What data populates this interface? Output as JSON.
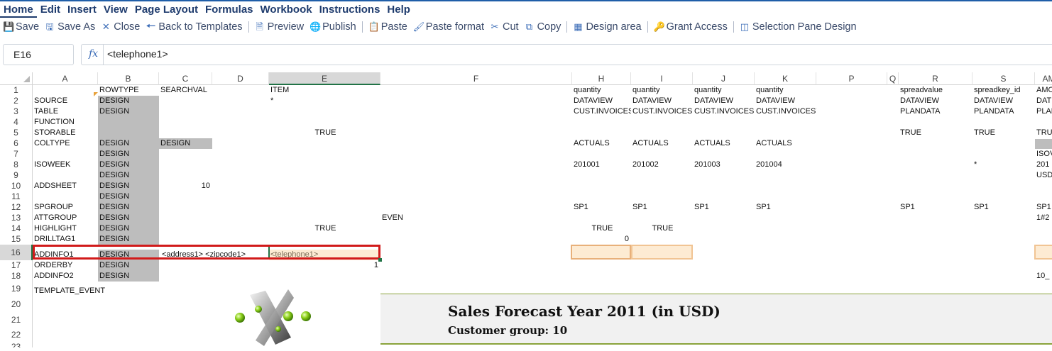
{
  "menu": [
    "Home",
    "Edit",
    "Insert",
    "View",
    "Page Layout",
    "Formulas",
    "Workbook",
    "Instructions",
    "Help"
  ],
  "toolbar": [
    {
      "label": "Save",
      "icon": "save-icon"
    },
    {
      "label": "Save As",
      "icon": "save-as-icon"
    },
    {
      "label": "Close",
      "icon": "close-icon"
    },
    {
      "label": "Back to Templates",
      "icon": "arrow-left-icon"
    },
    {
      "label": "Preview",
      "icon": "preview-icon"
    },
    {
      "label": "Publish",
      "icon": "globe-icon"
    },
    {
      "label": "Paste",
      "icon": "paste-icon"
    },
    {
      "label": "Paste format",
      "icon": "format-painter-icon"
    },
    {
      "label": "Cut",
      "icon": "scissors-icon"
    },
    {
      "label": "Copy",
      "icon": "copy-icon"
    },
    {
      "label": "Design area",
      "icon": "grid-icon"
    },
    {
      "label": "Grant Access",
      "icon": "key-icon"
    },
    {
      "label": "Selection Pane Design",
      "icon": "selection-pane-icon"
    }
  ],
  "namebox": "E16",
  "formula": "<telephone1>",
  "columns": [
    "A",
    "B",
    "C",
    "D",
    "E",
    "F",
    "H",
    "I",
    "J",
    "K",
    "P",
    "Q",
    "R",
    "S",
    "AM"
  ],
  "rows": [
    "1",
    "2",
    "3",
    "4",
    "5",
    "6",
    "7",
    "8",
    "9",
    "10",
    "11",
    "12",
    "13",
    "14",
    "15",
    "16",
    "17",
    "18",
    "19",
    "20",
    "21",
    "22",
    "23"
  ],
  "cells": {
    "A": [
      "",
      "SOURCE",
      "TABLE",
      "FUNCTION",
      "STORABLE",
      "COLTYPE",
      "",
      "ISOWEEK",
      "",
      "ADDSHEET",
      "",
      "SPGROUP",
      "ATTGROUP",
      "HIGHLIGHT",
      "DRILLTAG1",
      "ADDINFO1",
      "ORDERBY",
      "ADDINFO2",
      "TEMPLATE_EVENT"
    ],
    "B": [
      "ROWTYPE",
      "DESIGN",
      "DESIGN",
      "",
      "",
      "DESIGN",
      "DESIGN",
      "DESIGN",
      "DESIGN",
      "DESIGN",
      "DESIGN",
      "DESIGN",
      "DESIGN",
      "DESIGN",
      "DESIGN",
      "DESIGN",
      "DESIGN",
      "DESIGN"
    ],
    "C1": "SEARCHVAL",
    "C6": "DESIGN",
    "C10": "10",
    "C16": "<address1>  <zipcode1>",
    "E1": "ITEM",
    "E2": "*",
    "E5": "TRUE",
    "E14": "TRUE",
    "E16": "<telephone1>",
    "E17": "1",
    "F13": "EVEN",
    "H": [
      "quantity",
      "DATAVIEW",
      "CUST.INVOICES",
      "",
      "",
      "ACTUALS",
      "",
      "201001",
      "",
      "",
      "",
      "SP1",
      "",
      "TRUE",
      "0"
    ],
    "I": [
      "quantity",
      "DATAVIEW",
      "CUST.INVOICES",
      "",
      "",
      "ACTUALS",
      "",
      "201002",
      "",
      "",
      "",
      "SP1",
      "",
      "TRUE"
    ],
    "J": [
      "quantity",
      "DATAVIEW",
      "CUST.INVOICES",
      "",
      "",
      "ACTUALS",
      "",
      "201003",
      "",
      "",
      "",
      "SP1"
    ],
    "K": [
      "quantity",
      "DATAVIEW",
      "CUST.INVOICESTAT",
      "",
      "",
      "ACTUALS",
      "",
      "201004",
      "",
      "",
      "",
      "SP1"
    ],
    "R": [
      "spreadvalue",
      "DATAVIEW",
      "PLANDATA",
      "",
      "TRUE",
      "",
      "",
      "",
      "",
      "",
      "",
      "SP1"
    ],
    "S": [
      "spreadkey_id",
      "DATAVIEW",
      "PLANDATA",
      "",
      "TRUE",
      "",
      "",
      "*",
      "",
      "",
      "",
      "SP1"
    ],
    "AM": [
      "AMO",
      "DAT",
      "PLAN",
      "",
      "TRU",
      "",
      "ISOV",
      "201",
      "USD",
      "",
      "",
      "SP1",
      "1#2",
      "",
      "",
      "",
      "",
      "10_"
    ]
  },
  "banner": {
    "title": "Sales Forecast Year 2011 (in USD)",
    "subtitle": "Customer group: 10"
  },
  "colors": {
    "accent": "#1f5ea8",
    "selected_border": "#d11a1a",
    "design_fill": "#bdbdbd",
    "banner_line": "#8aa33b"
  }
}
